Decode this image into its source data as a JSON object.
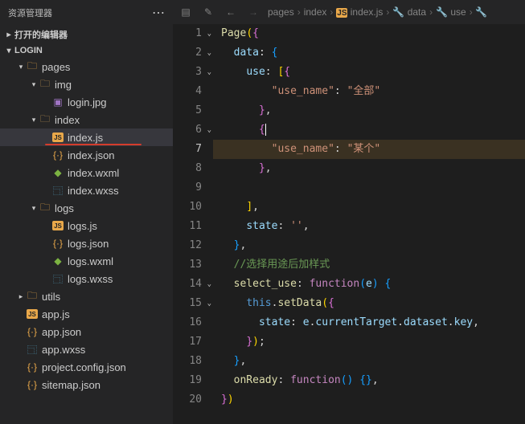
{
  "sidebar": {
    "title": "资源管理器",
    "sections": {
      "openEditors": "打开的编辑器",
      "project": "LOGIN"
    },
    "tree": [
      {
        "label": "pages",
        "icon": "folder-pages",
        "indent": 1,
        "expanded": true
      },
      {
        "label": "img",
        "icon": "folder",
        "indent": 2,
        "expanded": true
      },
      {
        "label": "login.jpg",
        "icon": "img",
        "indent": 3
      },
      {
        "label": "index",
        "icon": "folder",
        "indent": 2,
        "expanded": true
      },
      {
        "label": "index.js",
        "icon": "js",
        "indent": 3,
        "active": true,
        "underline": true
      },
      {
        "label": "index.json",
        "icon": "json",
        "indent": 3
      },
      {
        "label": "index.wxml",
        "icon": "wxml",
        "indent": 3
      },
      {
        "label": "index.wxss",
        "icon": "wxss",
        "indent": 3
      },
      {
        "label": "logs",
        "icon": "folder-pages",
        "indent": 2,
        "expanded": true
      },
      {
        "label": "logs.js",
        "icon": "js",
        "indent": 3
      },
      {
        "label": "logs.json",
        "icon": "json",
        "indent": 3
      },
      {
        "label": "logs.wxml",
        "icon": "wxml",
        "indent": 3
      },
      {
        "label": "logs.wxss",
        "icon": "wxss",
        "indent": 3
      },
      {
        "label": "utils",
        "icon": "folder-pages",
        "indent": 1,
        "expanded": false
      },
      {
        "label": "app.js",
        "icon": "js",
        "indent": 1
      },
      {
        "label": "app.json",
        "icon": "json",
        "indent": 1
      },
      {
        "label": "app.wxss",
        "icon": "wxss",
        "indent": 1
      },
      {
        "label": "project.config.json",
        "icon": "json",
        "indent": 1
      },
      {
        "label": "sitemap.json",
        "icon": "json",
        "indent": 1
      }
    ]
  },
  "breadcrumb": {
    "items": [
      "pages",
      "index",
      "index.js",
      "data",
      "use"
    ],
    "fileIcon": "js"
  },
  "code": {
    "lines": [
      {
        "n": 1,
        "fold": "down",
        "tokens": [
          [
            "fn",
            "Page"
          ],
          [
            "brace",
            "("
          ],
          [
            "brace2",
            "{"
          ]
        ]
      },
      {
        "n": 2,
        "fold": "down",
        "tokens": [
          [
            "white",
            "  "
          ],
          [
            "prop",
            "data"
          ],
          [
            "punc",
            ": "
          ],
          [
            "brace3",
            "{"
          ]
        ]
      },
      {
        "n": 3,
        "fold": "down",
        "tokens": [
          [
            "white",
            "    "
          ],
          [
            "prop",
            "use"
          ],
          [
            "punc",
            ": "
          ],
          [
            "brace",
            "["
          ],
          [
            "brace2",
            "{"
          ]
        ]
      },
      {
        "n": 4,
        "tokens": [
          [
            "white",
            "        "
          ],
          [
            "str",
            "\"use_name\""
          ],
          [
            "punc",
            ": "
          ],
          [
            "str2",
            "\"全部\""
          ]
        ]
      },
      {
        "n": 5,
        "tokens": [
          [
            "white",
            "      "
          ],
          [
            "brace2",
            "}"
          ],
          [
            "punc",
            ","
          ]
        ]
      },
      {
        "n": 6,
        "fold": "down",
        "tokens": [
          [
            "white",
            "      "
          ],
          [
            "brace2",
            "{"
          ],
          [
            "cursor",
            ""
          ]
        ]
      },
      {
        "n": 7,
        "hl": true,
        "tokens": [
          [
            "white",
            "        "
          ],
          [
            "str",
            "\"use_name\""
          ],
          [
            "punc",
            ": "
          ],
          [
            "str2",
            "\"某个\""
          ]
        ]
      },
      {
        "n": 8,
        "tokens": [
          [
            "white",
            "      "
          ],
          [
            "brace2",
            "}"
          ],
          [
            "punc",
            ","
          ]
        ]
      },
      {
        "n": 9,
        "tokens": [
          [
            "white",
            ""
          ]
        ]
      },
      {
        "n": 10,
        "tokens": [
          [
            "white",
            "    "
          ],
          [
            "brace",
            "]"
          ],
          [
            "punc",
            ","
          ]
        ]
      },
      {
        "n": 11,
        "tokens": [
          [
            "white",
            "    "
          ],
          [
            "prop",
            "state"
          ],
          [
            "punc",
            ": "
          ],
          [
            "str",
            "''"
          ],
          [
            "punc",
            ","
          ]
        ]
      },
      {
        "n": 12,
        "tokens": [
          [
            "white",
            "  "
          ],
          [
            "brace3",
            "}"
          ],
          [
            "punc",
            ","
          ]
        ]
      },
      {
        "n": 13,
        "tokens": [
          [
            "white",
            "  "
          ],
          [
            "comment",
            "//选择用途后加样式"
          ]
        ]
      },
      {
        "n": 14,
        "fold": "down",
        "tokens": [
          [
            "white",
            "  "
          ],
          [
            "fn",
            "select_use"
          ],
          [
            "punc",
            ": "
          ],
          [
            "kw",
            "function"
          ],
          [
            "brace3",
            "("
          ],
          [
            "var",
            "e"
          ],
          [
            "brace3",
            ") "
          ],
          [
            "brace3",
            "{"
          ]
        ]
      },
      {
        "n": 15,
        "fold": "down",
        "tokens": [
          [
            "white",
            "    "
          ],
          [
            "this",
            "this"
          ],
          [
            "punc",
            "."
          ],
          [
            "fn",
            "setData"
          ],
          [
            "brace",
            "("
          ],
          [
            "brace2",
            "{"
          ]
        ]
      },
      {
        "n": 16,
        "tokens": [
          [
            "white",
            "      "
          ],
          [
            "prop",
            "state"
          ],
          [
            "punc",
            ": "
          ],
          [
            "var",
            "e"
          ],
          [
            "punc",
            "."
          ],
          [
            "var",
            "currentTarget"
          ],
          [
            "punc",
            "."
          ],
          [
            "var",
            "dataset"
          ],
          [
            "punc",
            "."
          ],
          [
            "var",
            "key"
          ],
          [
            "punc",
            ","
          ]
        ]
      },
      {
        "n": 17,
        "tokens": [
          [
            "white",
            "    "
          ],
          [
            "brace2",
            "}"
          ],
          [
            "brace",
            ")"
          ],
          [
            "punc",
            ";"
          ]
        ]
      },
      {
        "n": 18,
        "tokens": [
          [
            "white",
            "  "
          ],
          [
            "brace3",
            "}"
          ],
          [
            "punc",
            ","
          ]
        ]
      },
      {
        "n": 19,
        "tokens": [
          [
            "white",
            "  "
          ],
          [
            "fn",
            "onReady"
          ],
          [
            "punc",
            ": "
          ],
          [
            "kw",
            "function"
          ],
          [
            "brace3",
            "() "
          ],
          [
            "brace3",
            "{}"
          ],
          [
            "punc",
            ","
          ]
        ]
      },
      {
        "n": 20,
        "tokens": [
          [
            "brace2",
            "}"
          ],
          [
            "brace",
            ")"
          ]
        ]
      }
    ]
  }
}
